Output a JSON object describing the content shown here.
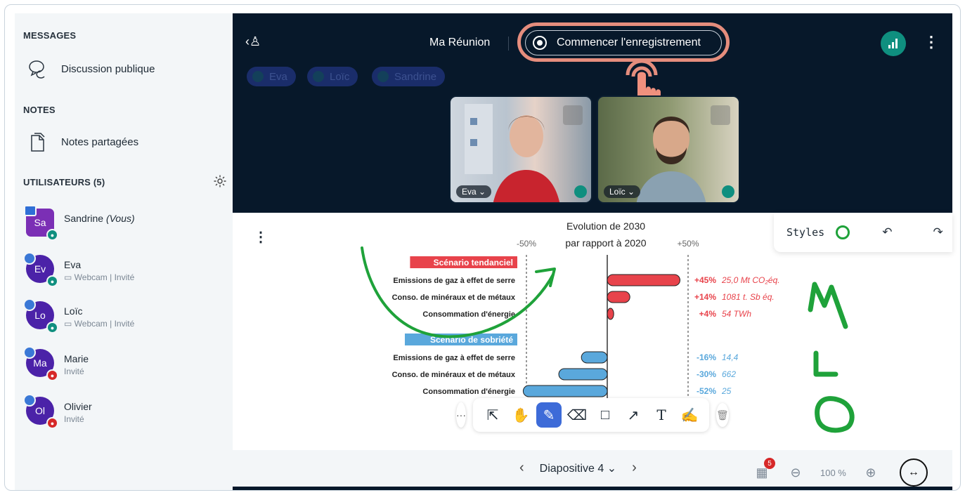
{
  "sidebar": {
    "messages_title": "MESSAGES",
    "public_chat": "Discussion publique",
    "notes_title": "NOTES",
    "shared_notes": "Notes partagées",
    "users_title": "UTILISATEURS (5)",
    "users": [
      {
        "initials": "Sa",
        "name": "Sandrine",
        "suffix": "(Vous)",
        "sub": "",
        "color": "#7b2fb5"
      },
      {
        "initials": "Ev",
        "name": "Eva",
        "suffix": "",
        "sub": "Webcam | Invité",
        "color": "#4b22a8"
      },
      {
        "initials": "Lo",
        "name": "Loïc",
        "suffix": "",
        "sub": "Webcam | Invité",
        "color": "#4b22a8"
      },
      {
        "initials": "Ma",
        "name": "Marie",
        "suffix": "",
        "sub": "Invité",
        "color": "#4b22a8"
      },
      {
        "initials": "Ol",
        "name": "Olivier",
        "suffix": "",
        "sub": "Invité",
        "color": "#4b22a8"
      }
    ]
  },
  "header": {
    "meeting_title": "Ma Réunion",
    "record_label": "Commencer l'enregistrement",
    "talkers": [
      "Eva",
      "Loïc",
      "Sandrine"
    ]
  },
  "videos": [
    {
      "name": "Eva"
    },
    {
      "name": "Loïc"
    }
  ],
  "chart_data": {
    "type": "bar",
    "title": "Evolution de 2030\npar rapport à 2020",
    "xlim": [
      -50,
      50
    ],
    "xticks": [
      "-50%",
      "+50%"
    ],
    "groups": [
      {
        "name": "Scénario tendanciel",
        "color": "#e8434b",
        "categories": [
          "Emissions de gaz à effet de serre",
          "Conso. de minéraux et de métaux",
          "Consommation d'énergie"
        ],
        "values": [
          45,
          14,
          4
        ],
        "labels": [
          "+45%",
          "+14%",
          "+4%"
        ],
        "annotations": [
          "25,0 Mt CO₂éq.",
          "1081 t. Sb éq.",
          "54 TWh"
        ]
      },
      {
        "name": "Scénario de sobriété",
        "color": "#5aa8dc",
        "categories": [
          "Emissions de gaz à effet de serre",
          "Conso. de minéraux et de métaux",
          "Consommation d'énergie"
        ],
        "values": [
          -16,
          -30,
          -52
        ],
        "labels": [
          "-16%",
          "-30%",
          "-52%"
        ],
        "annotations": [
          "14,4",
          "662",
          "25"
        ]
      }
    ]
  },
  "board": {
    "styles_label": "Styles",
    "handwriting": [
      "M",
      "L",
      "O"
    ]
  },
  "footer": {
    "slide_label": "Diapositive 4",
    "zoom": "100 %",
    "poll_badge": "5"
  },
  "colors": {
    "accent": "#3d6bd8",
    "dark_bg": "#07182a",
    "record_ring": "#e58d7d"
  }
}
